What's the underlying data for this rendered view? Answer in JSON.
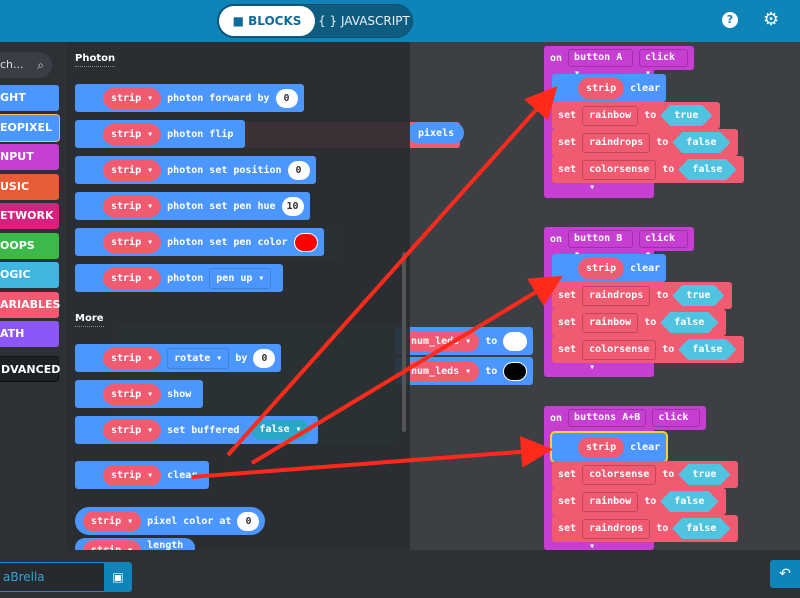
{
  "topbar": {
    "modes": [
      {
        "label": "BLOCKS",
        "icon": "puzzle-icon",
        "active": true
      },
      {
        "label": "{ } JAVASCRIPT",
        "active": false
      }
    ],
    "help_icon": "?",
    "settings_icon": "⚙"
  },
  "toolbox": {
    "search_placeholder": "Search...",
    "search_display": "ch...",
    "categories": [
      {
        "label": "GHT",
        "full": "LIGHT",
        "color": "#4c97ff"
      },
      {
        "label": "EOPIXEL",
        "full": "NEOPIXEL",
        "color": "#4c97ff",
        "selected": true
      },
      {
        "label": "NPUT",
        "full": "INPUT",
        "color": "#c63ed2"
      },
      {
        "label": "USIC",
        "full": "MUSIC",
        "color": "#e75b37"
      },
      {
        "label": "ETWORK",
        "full": "NETWORK",
        "color": "#d6217f"
      },
      {
        "label": "OOPS",
        "full": "LOOPS",
        "color": "#3cb94a"
      },
      {
        "label": "OGIC",
        "full": "LOGIC",
        "color": "#3fb5e0"
      },
      {
        "label": "ARIABLES",
        "full": "VARIABLES",
        "color": "#f05b72"
      },
      {
        "label": "ATH",
        "full": "MATH",
        "color": "#8c57f9"
      },
      {
        "label": "DVANCED",
        "full": "ADVANCED",
        "color": "#1e2226"
      }
    ]
  },
  "flyout": {
    "section_photon": "Photon",
    "section_more": "More",
    "strip_label": "strip ▾",
    "photon_blocks": [
      {
        "text": "photon forward by",
        "value": "0"
      },
      {
        "text": "photon flip"
      },
      {
        "text": "photon set position",
        "value": "0"
      },
      {
        "text": "photon set pen hue",
        "value": "10"
      },
      {
        "text": "photon set pen color",
        "color": "#ff0000"
      },
      {
        "text": "photon",
        "dropdown": "pen up ▾"
      }
    ],
    "more_blocks": [
      {
        "dropdown": "rotate ▾",
        "text": "by",
        "value": "0"
      },
      {
        "text": "show"
      },
      {
        "text": "set buffered",
        "bool": "false ▾"
      },
      {
        "text": "clear"
      }
    ],
    "reporter_blocks": [
      {
        "text": "pixel color at",
        "value": "0"
      },
      {
        "text": "length"
      }
    ]
  },
  "workspace": {
    "background_blocks": [
      {
        "text": "pixels"
      },
      {
        "var": "num_leds ▾",
        "text": "to",
        "color": "#ffffff"
      },
      {
        "var": "num_leds ▾",
        "text": "to",
        "color": "#000000"
      }
    ],
    "events": [
      {
        "on": "on",
        "button": "button A ▾",
        "action": "click ▾",
        "clear": {
          "strip": "strip ▾",
          "text": "clear"
        },
        "sets": [
          {
            "set": "set",
            "var": "rainbow ▾",
            "to": "to",
            "value": "true ▾"
          },
          {
            "set": "set",
            "var": "raindrops ▾",
            "to": "to",
            "value": "false ▾"
          },
          {
            "set": "set",
            "var": "colorsense ▾",
            "to": "to",
            "value": "false ▾"
          }
        ]
      },
      {
        "on": "on",
        "button": "button B ▾",
        "action": "click ▾",
        "clear": {
          "strip": "strip ▾",
          "text": "clear"
        },
        "sets": [
          {
            "set": "set",
            "var": "raindrops ▾",
            "to": "to",
            "value": "true ▾"
          },
          {
            "set": "set",
            "var": "rainbow ▾",
            "to": "to",
            "value": "false ▾"
          },
          {
            "set": "set",
            "var": "colorsense ▾",
            "to": "to",
            "value": "false ▾"
          }
        ]
      },
      {
        "on": "on",
        "button": "buttons A+B ▾",
        "action": "click ▾",
        "clear": {
          "strip": "strip ▾",
          "text": "clear",
          "selected": true
        },
        "sets": [
          {
            "set": "set",
            "var": "colorsense ▾",
            "to": "to",
            "value": "true ▾"
          },
          {
            "set": "set",
            "var": "rainbow ▾",
            "to": "to",
            "value": "false ▾"
          },
          {
            "set": "set",
            "var": "raindrops ▾",
            "to": "to",
            "value": "false ▾"
          }
        ]
      }
    ]
  },
  "annotation": {
    "arrow_color": "#ff2a1a"
  },
  "bottombar": {
    "project_name": "aBrella",
    "save_icon": "💾",
    "undo_icon": "↶"
  }
}
